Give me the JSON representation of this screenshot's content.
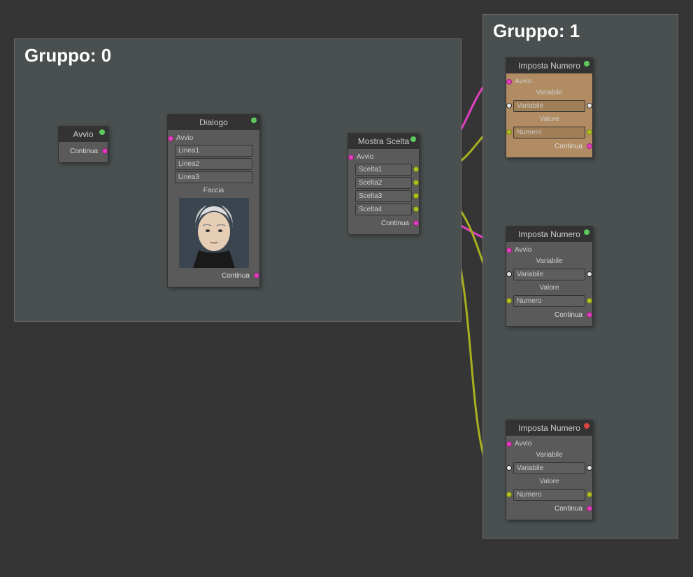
{
  "groups": [
    {
      "label": "Gruppo: 0"
    },
    {
      "label": "Gruppo: 1"
    }
  ],
  "nodes": {
    "avvio": {
      "title": "Avvio",
      "continua": "Continua",
      "status": "green"
    },
    "dialogo": {
      "title": "Dialogo",
      "avvio": "Avvio",
      "linea1": "Linea1",
      "linea2": "Linea2",
      "linea3": "Linea3",
      "faccia": "Faccia",
      "continua": "Continua",
      "status": "green"
    },
    "mostra": {
      "title": "Mostra Scelta",
      "avvio": "Avvio",
      "scelta1": "Scelta1",
      "scelta2": "Scelta2",
      "scelta3": "Scelta3",
      "scelta4": "Scelta4",
      "continua": "Continua",
      "status": "green"
    },
    "imposta1": {
      "title": "Imposta Numero",
      "avvio": "Avvio",
      "variabile_label": "Variabile",
      "variabile": "Variabile",
      "valore_label": "Valore",
      "numero": "Numero",
      "continua": "Continua",
      "status": "green"
    },
    "imposta2": {
      "title": "Imposta Numero",
      "avvio": "Avvio",
      "variabile_label": "Variabile",
      "variabile": "Variabile",
      "valore_label": "Valore",
      "numero": "Numero",
      "continua": "Continua",
      "status": "green"
    },
    "imposta3": {
      "title": "Imposta Numero",
      "avvio": "Avvio",
      "variabile_label": "Variabile",
      "variabile": "Variabile",
      "valore_label": "Valore",
      "numero": "Numero",
      "continua": "Continua",
      "status": "red"
    }
  },
  "colors": {
    "magenta": "#e040c0",
    "olive": "#a8b020"
  }
}
